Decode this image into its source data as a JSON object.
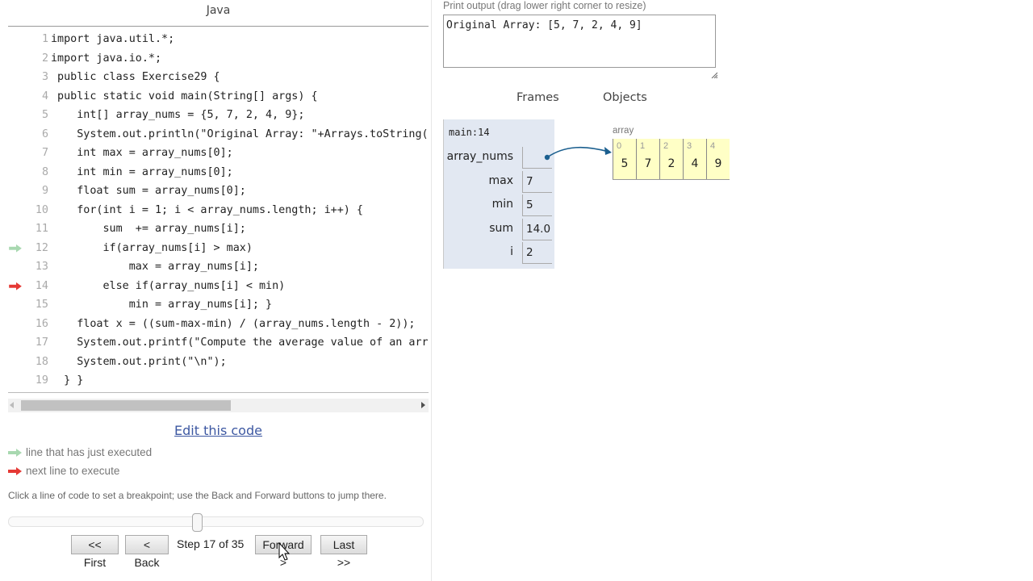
{
  "editor": {
    "language": "Java",
    "current_line": 14,
    "previous_line": 12,
    "lines": [
      {
        "n": "1",
        "text": "import java.util.*;",
        "marker": ""
      },
      {
        "n": "2",
        "text": "import java.io.*;",
        "marker": ""
      },
      {
        "n": "3",
        "text": " public class Exercise29 {",
        "marker": ""
      },
      {
        "n": "4",
        "text": " public static void main(String[] args) {",
        "marker": ""
      },
      {
        "n": "5",
        "text": "    int[] array_nums = {5, 7, 2, 4, 9};",
        "marker": ""
      },
      {
        "n": "6",
        "text": "    System.out.println(\"Original Array: \"+Arrays.toString(arr",
        "marker": ""
      },
      {
        "n": "7",
        "text": "    int max = array_nums[0];",
        "marker": ""
      },
      {
        "n": "8",
        "text": "    int min = array_nums[0];",
        "marker": ""
      },
      {
        "n": "9",
        "text": "    float sum = array_nums[0];",
        "marker": ""
      },
      {
        "n": "10",
        "text": "    for(int i = 1; i < array_nums.length; i++) {",
        "marker": ""
      },
      {
        "n": "11",
        "text": "        sum  += array_nums[i];",
        "marker": ""
      },
      {
        "n": "12",
        "text": "        if(array_nums[i] > max)",
        "marker": "executed"
      },
      {
        "n": "13",
        "text": "            max = array_nums[i];",
        "marker": ""
      },
      {
        "n": "14",
        "text": "        else if(array_nums[i] < min)",
        "marker": "next"
      },
      {
        "n": "15",
        "text": "            min = array_nums[i]; }",
        "marker": ""
      },
      {
        "n": "16",
        "text": "    float x = ((sum-max-min) / (array_nums.length - 2));",
        "marker": ""
      },
      {
        "n": "17",
        "text": "    System.out.printf(\"Compute the average value of an array ",
        "marker": ""
      },
      {
        "n": "18",
        "text": "    System.out.print(\"\\n\");",
        "marker": ""
      },
      {
        "n": "19",
        "text": "  } }",
        "marker": ""
      }
    ]
  },
  "controls": {
    "edit_link": "Edit this code",
    "legend_executed": "line that has just executed",
    "legend_next": "next line to execute",
    "breakpoint_hint": "Click a line of code to set a breakpoint; use the Back and Forward buttons to jump there.",
    "first_label": "<< First",
    "back_label": "< Back",
    "step_label": "Step 17 of 35",
    "forward_label": "Forward >",
    "last_label": "Last >>",
    "step_current": 17,
    "step_total": 35,
    "slider_fraction": 0.4571
  },
  "output": {
    "label": "Print output (drag lower right corner to resize)",
    "text": "Original Array: [5, 7, 2, 4, 9]"
  },
  "visualization": {
    "frames_header": "Frames",
    "objects_header": "Objects",
    "frame": {
      "name": "main:14",
      "vars": [
        {
          "name": "array_nums",
          "value": "",
          "pointer": true
        },
        {
          "name": "max",
          "value": "7"
        },
        {
          "name": "min",
          "value": "5"
        },
        {
          "name": "sum",
          "value": "14.0"
        },
        {
          "name": "i",
          "value": "2"
        }
      ]
    },
    "array": {
      "label": "array",
      "cells": [
        {
          "index": "0",
          "value": "5"
        },
        {
          "index": "1",
          "value": "7"
        },
        {
          "index": "2",
          "value": "2"
        },
        {
          "index": "3",
          "value": "4"
        },
        {
          "index": "4",
          "value": "9"
        }
      ]
    }
  },
  "colors": {
    "executed_arrow": "#a8d8b0",
    "next_arrow": "#e53935",
    "frame_bg": "#e2e8f2",
    "array_bg": "#ffffc6",
    "pointer": "#1b5f8f",
    "link": "#3d58a2"
  }
}
